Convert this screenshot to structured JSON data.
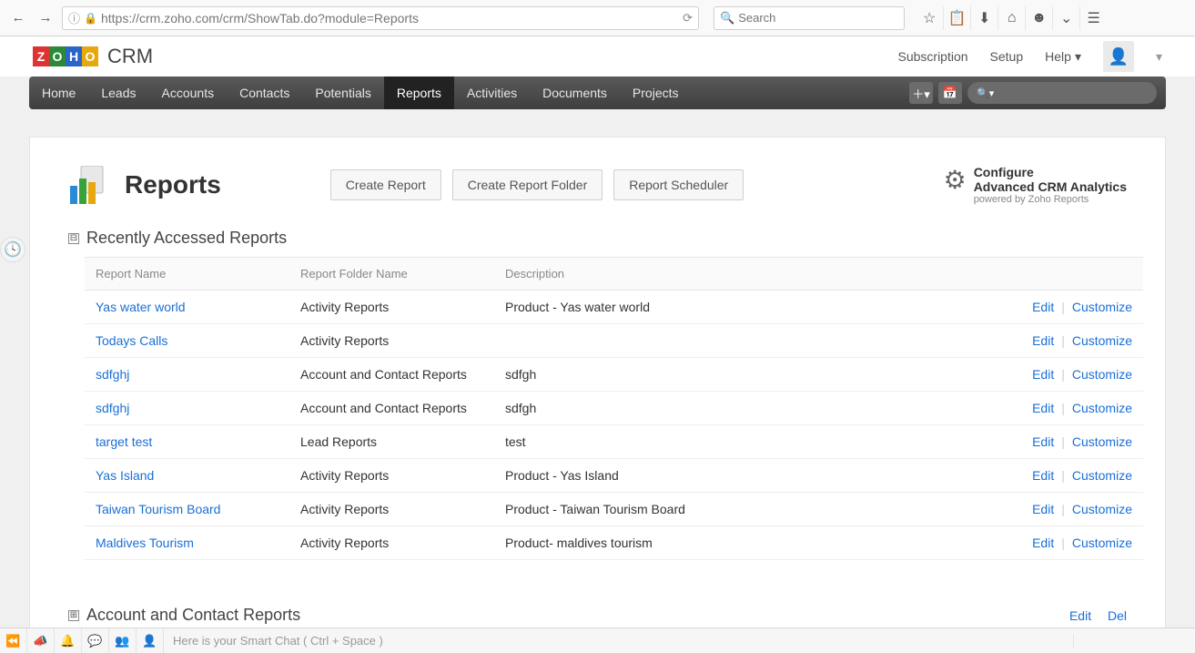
{
  "browser": {
    "url": "https://crm.zoho.com/crm/ShowTab.do?module=Reports",
    "search_placeholder": "Search"
  },
  "header": {
    "links": {
      "subscription": "Subscription",
      "setup": "Setup",
      "help": "Help"
    }
  },
  "tabs": [
    "Home",
    "Leads",
    "Accounts",
    "Contacts",
    "Potentials",
    "Reports",
    "Activities",
    "Documents",
    "Projects"
  ],
  "active_tab": "Reports",
  "page": {
    "title": "Reports",
    "buttons": {
      "create_report": "Create Report",
      "create_folder": "Create Report Folder",
      "scheduler": "Report Scheduler"
    },
    "configure": {
      "line1": "Configure",
      "line2": "Advanced CRM Analytics",
      "powered": "powered by Zoho Reports"
    }
  },
  "section1": {
    "title": "Recently Accessed Reports",
    "collapse_glyph": "⊟",
    "columns": [
      "Report Name",
      "Report Folder Name",
      "Description"
    ],
    "action_edit": "Edit",
    "action_customize": "Customize",
    "rows": [
      {
        "name": "Yas water world",
        "folder": "Activity Reports",
        "desc": "Product - Yas water world"
      },
      {
        "name": "Todays Calls",
        "folder": "Activity Reports",
        "desc": ""
      },
      {
        "name": "sdfghj",
        "folder": "Account and Contact Reports",
        "desc": "sdfgh"
      },
      {
        "name": "sdfghj",
        "folder": "Account and Contact Reports",
        "desc": "sdfgh"
      },
      {
        "name": "target test",
        "folder": "Lead Reports",
        "desc": "test"
      },
      {
        "name": "Yas Island",
        "folder": "Activity Reports",
        "desc": "Product - Yas Island"
      },
      {
        "name": "Taiwan Tourism Board",
        "folder": "Activity Reports",
        "desc": "Product - Taiwan Tourism Board"
      },
      {
        "name": "Maldives Tourism",
        "folder": "Activity Reports",
        "desc": "Product- maldives tourism"
      }
    ]
  },
  "section2": {
    "title": "Account and Contact Reports",
    "collapse_glyph": "⊞",
    "action_edit": "Edit",
    "action_del": "Del"
  },
  "chatbar": {
    "placeholder": "Here is your Smart Chat ( Ctrl + Space )"
  }
}
